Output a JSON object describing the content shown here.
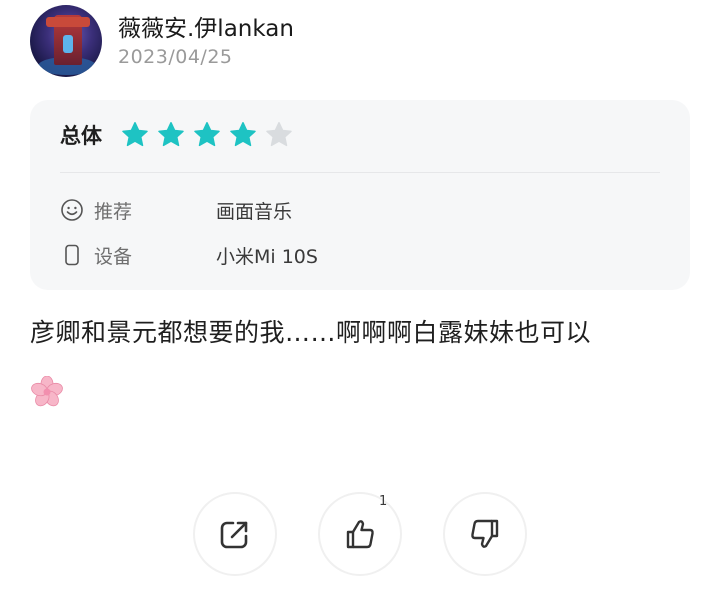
{
  "user": {
    "name": "薇薇安.伊lankan",
    "date": "2023/04/25"
  },
  "rating": {
    "label": "总体",
    "stars_filled": 4,
    "stars_total": 5,
    "star_color": "#1ec3c3",
    "star_empty_color": "#d9dcdf"
  },
  "details": [
    {
      "icon": "smiley-icon",
      "key": "推荐",
      "value": "画面音乐"
    },
    {
      "icon": "phone-icon",
      "key": "设备",
      "value": "小米Mi 10S"
    }
  ],
  "review": {
    "text": "彦卿和景元都想要的我……啊啊啊白露妹妹也可以",
    "emoji": "cherry-blossom-icon"
  },
  "actions": {
    "share_icon": "share-icon",
    "like_icon": "thumbs-up-icon",
    "like_count": "1",
    "dislike_icon": "thumbs-down-icon"
  }
}
